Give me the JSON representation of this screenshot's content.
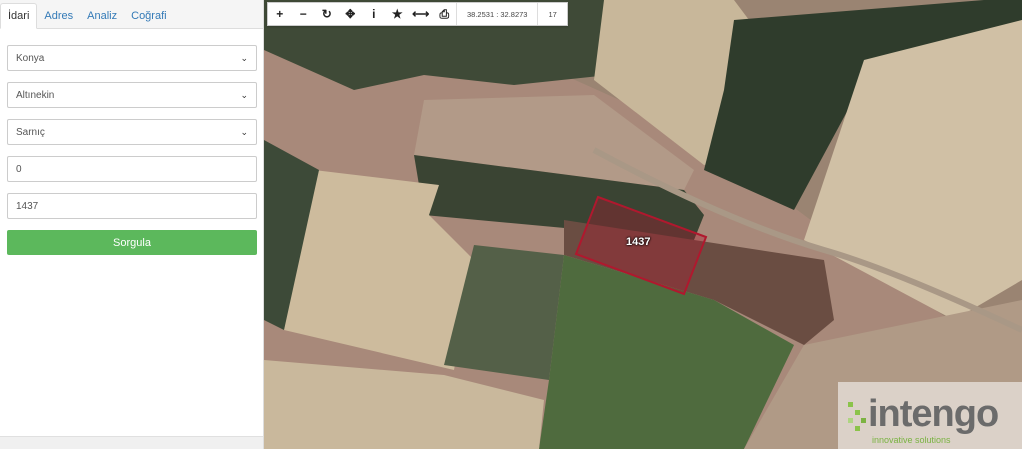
{
  "sidebar": {
    "tabs": [
      {
        "label": "İdari",
        "active": true
      },
      {
        "label": "Adres",
        "active": false
      },
      {
        "label": "Analiz",
        "active": false
      },
      {
        "label": "Coğrafi",
        "active": false
      }
    ],
    "selects": {
      "province": "Konya",
      "district": "Altınekin",
      "neighborhood": "Sarnıç"
    },
    "inputs": {
      "block": "0",
      "parcel": "1437"
    },
    "query_button": "Sorgula"
  },
  "map": {
    "toolbar": {
      "coordinates": "38.2531 : 32.8273",
      "zoom": "17"
    },
    "parcel_label": "1437",
    "parcel_color": "#b0182e",
    "logo": {
      "word": "intengo",
      "tagline": "innovative solutions"
    }
  }
}
